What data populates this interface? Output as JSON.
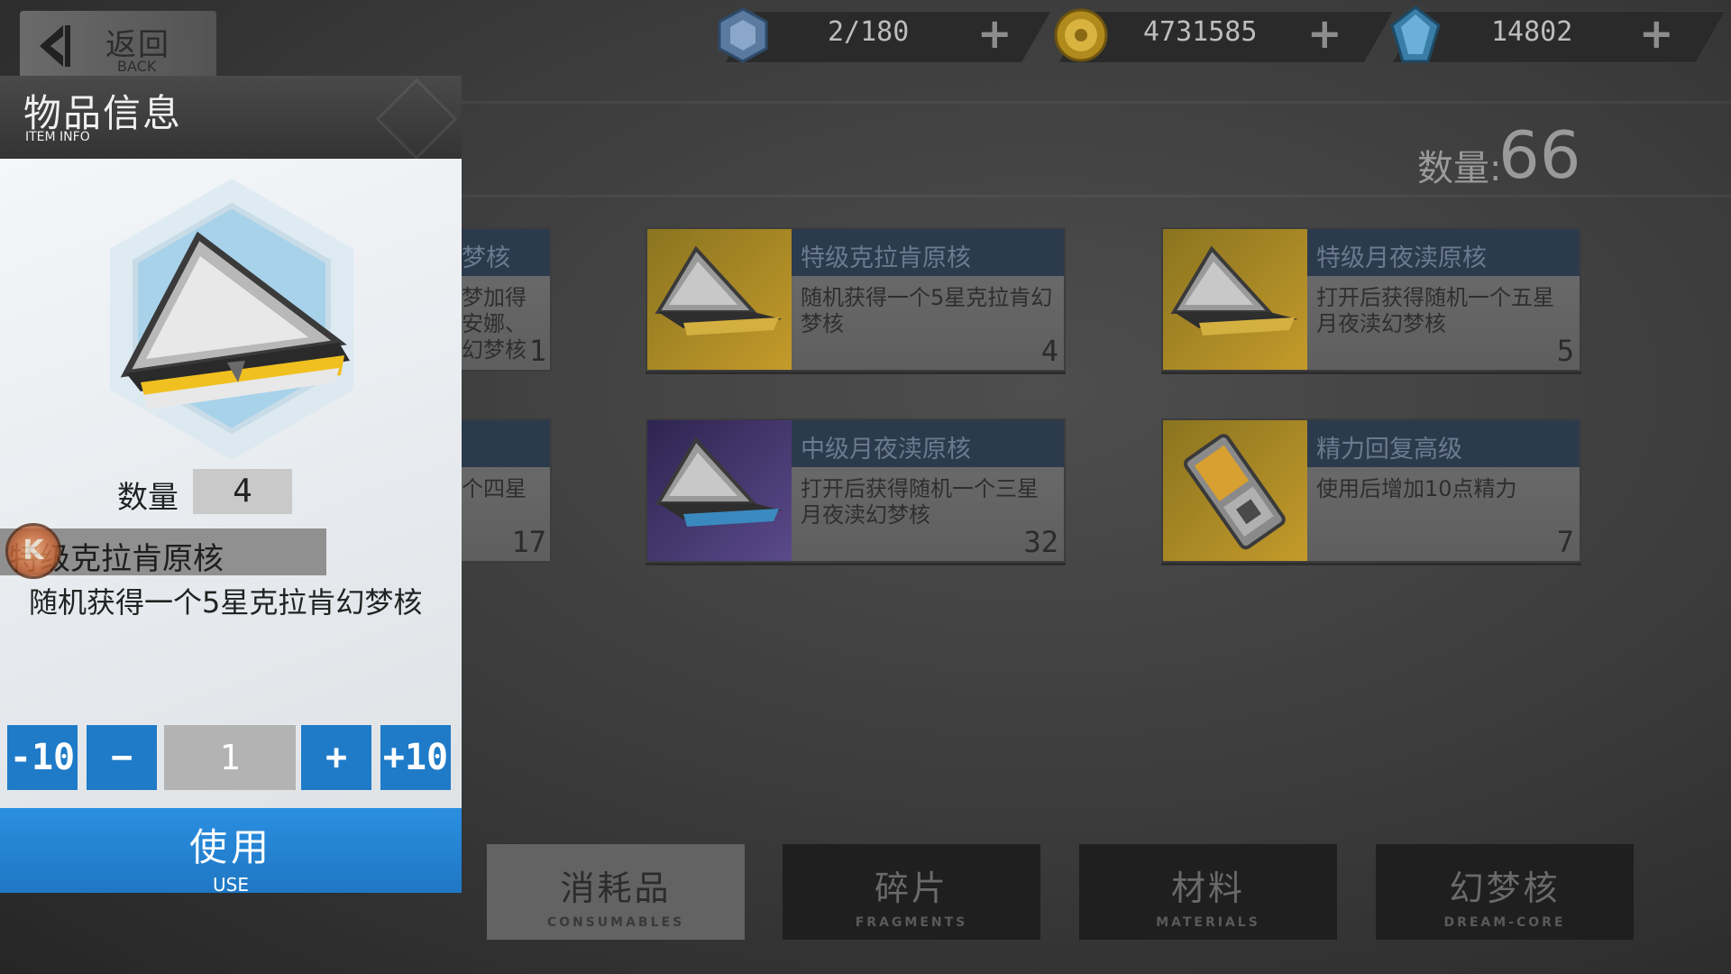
{
  "header": {
    "back_label": "返回",
    "back_sub": "BACK"
  },
  "resources": [
    {
      "icon": "stamina-icon",
      "value": "2/180",
      "plus": "+"
    },
    {
      "icon": "gold-coin-icon",
      "value": "4731585",
      "plus": "+"
    },
    {
      "icon": "crystal-icon",
      "value": "14802",
      "plus": "+"
    }
  ],
  "inventory": {
    "total_label": "数量:",
    "total_value": "66",
    "partial_items": [
      {
        "title": "梦核",
        "desc": "梦加得\n安娜、\n幻梦核",
        "count": "1"
      },
      {
        "title": "",
        "desc": "个四星",
        "count": "17"
      }
    ],
    "items": [
      {
        "title": "特级克拉肯原核",
        "desc": "随机获得一个5星克拉肯幻梦核",
        "count": "4",
        "theme": "gold"
      },
      {
        "title": "特级月夜渎原核",
        "desc": "打开后获得随机一个五星月夜渎幻梦核",
        "count": "5",
        "theme": "gold"
      },
      {
        "title": "中级月夜渎原核",
        "desc": "打开后获得随机一个三星月夜渎幻梦核",
        "count": "32",
        "theme": "purple"
      },
      {
        "title": "精力回复高级",
        "desc": "使用后增加10点精力",
        "count": "7",
        "theme": "gold"
      }
    ]
  },
  "tabs": [
    {
      "label": "消耗品",
      "sub": "CONSUMABLES",
      "active": true
    },
    {
      "label": "碎片",
      "sub": "FRAGMENTS",
      "active": false
    },
    {
      "label": "材料",
      "sub": "MATERIALS",
      "active": false
    },
    {
      "label": "幻梦核",
      "sub": "DREAM-CORE",
      "active": false
    }
  ],
  "panel": {
    "title": "物品信息",
    "subtitle": "ITEM INFO",
    "qty_label": "数量",
    "qty_value": "4",
    "rank_letter": "K",
    "item_name": "特级克拉肯原核",
    "item_desc": "随机获得一个5星克拉肯幻梦核",
    "stepper": {
      "minus10": "-10",
      "minus1": "−",
      "value": "1",
      "plus1": "+",
      "plus10": "+10"
    },
    "use_label": "使用",
    "use_sub": "USE"
  },
  "colors": {
    "accent_blue": "#1f7bc8",
    "card_title_bar": "#2c3a4d",
    "gold_thumb": "#c49a2a",
    "purple_thumb": "#4a3a7a"
  }
}
